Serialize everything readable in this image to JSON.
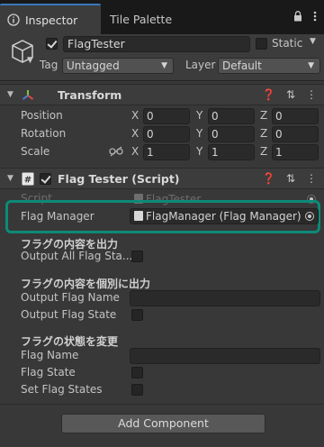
{
  "tabs": {
    "inspector": "Inspector",
    "tile_palette": "Tile Palette"
  },
  "header": {
    "object_name": "FlagTester",
    "static_label": "Static",
    "tag_label": "Tag",
    "tag_value": "Untagged",
    "layer_label": "Layer",
    "layer_value": "Default"
  },
  "transform": {
    "title": "Transform",
    "position_label": "Position",
    "rotation_label": "Rotation",
    "scale_label": "Scale",
    "axes": {
      "x": "X",
      "y": "Y",
      "z": "Z"
    },
    "position": [
      "0",
      "0",
      "0"
    ],
    "rotation": [
      "0",
      "0",
      "0"
    ],
    "scale": [
      "1",
      "1",
      "1"
    ]
  },
  "script_component": {
    "title": "Flag Tester (Script)",
    "script_label": "Script",
    "script_value": "FlagTester",
    "flag_manager_label": "Flag Manager",
    "flag_manager_value": "FlagManager (Flag Manager)",
    "section1_heading": "フラグの内容を出力",
    "output_all_label": "Output All Flag Sta...",
    "section2_heading": "フラグの内容を個別に出力",
    "output_flag_name_label": "Output Flag Name",
    "output_flag_state_label": "Output Flag State",
    "section3_heading": "フラグの状態を変更",
    "flag_name_label": "Flag Name",
    "flag_state_label": "Flag State",
    "set_flag_states_label": "Set Flag States"
  },
  "add_component": "Add Component",
  "colors": {
    "accent_blue": "#3a79bb",
    "highlight_teal": "#0d8a78",
    "panel_bg": "#383838"
  }
}
